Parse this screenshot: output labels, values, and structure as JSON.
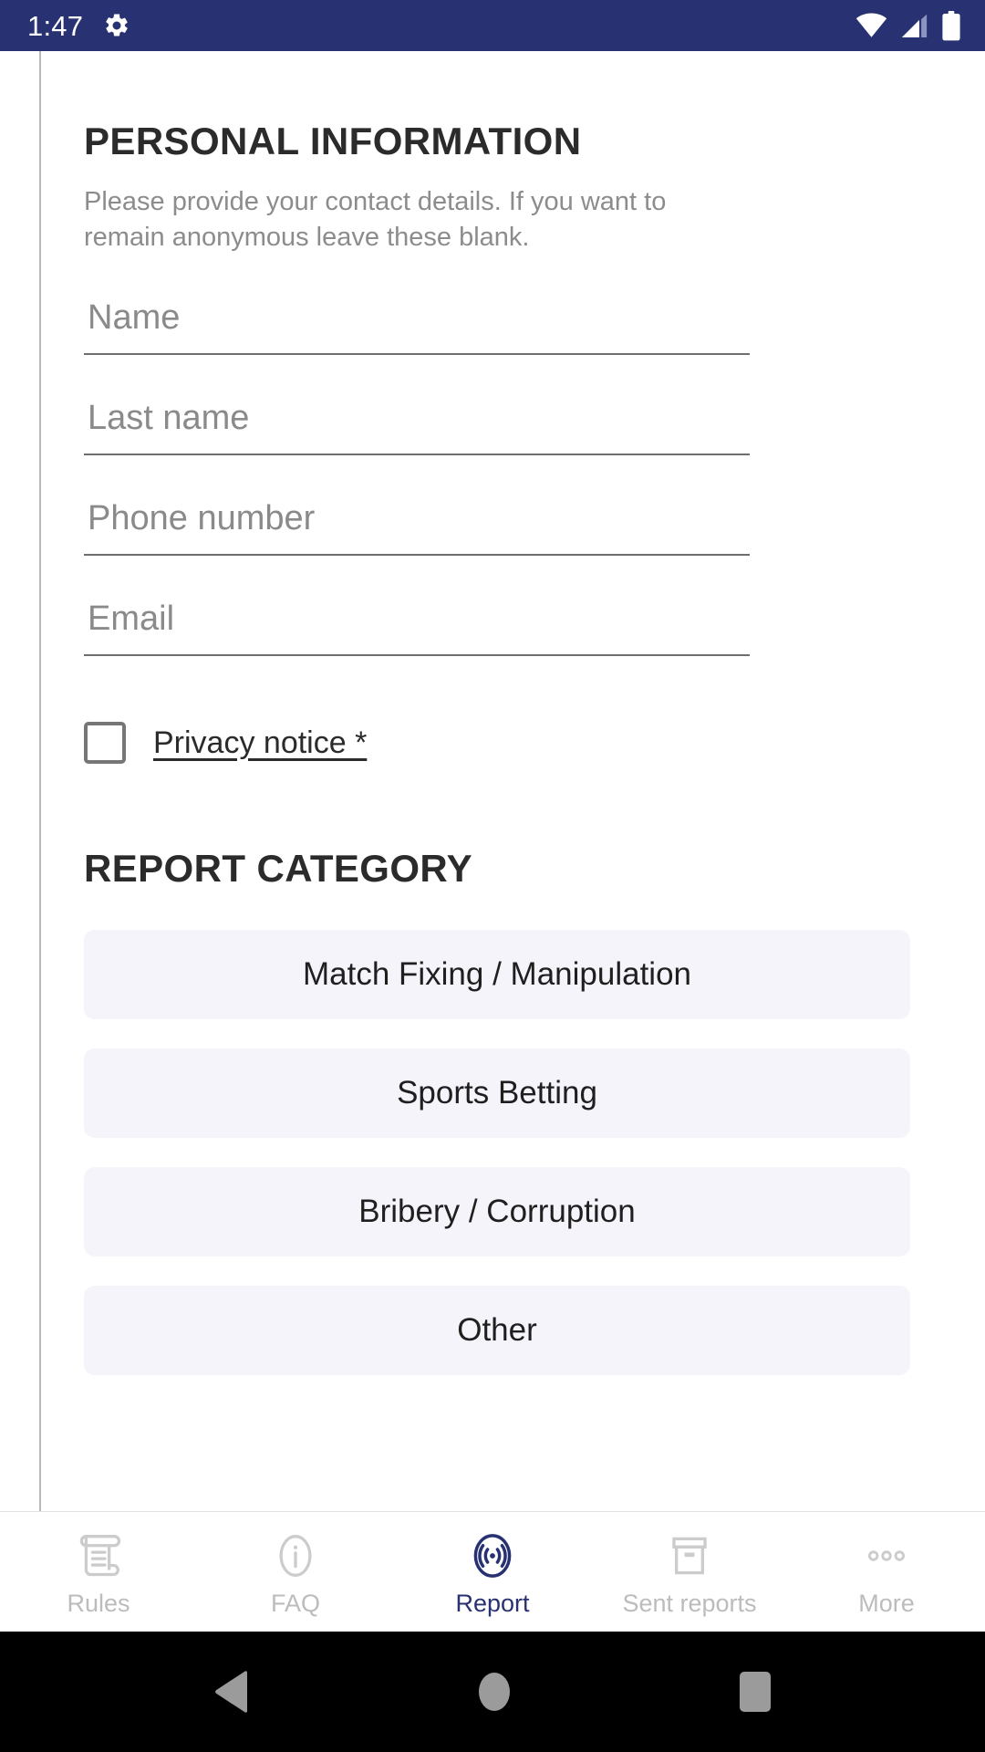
{
  "status_bar": {
    "time": "1:47",
    "gear_icon": "gear-icon",
    "wifi_icon": "wifi-icon",
    "signal_icon": "cell-signal-icon",
    "battery_icon": "battery-full-icon",
    "background_color": "#283272"
  },
  "sections": {
    "personal_information": {
      "title": "PERSONAL INFORMATION",
      "description": "Please provide your contact details. If you want to remain anonymous leave these blank.",
      "fields": [
        {
          "name": "name",
          "placeholder": "Name",
          "value": ""
        },
        {
          "name": "last_name",
          "placeholder": "Last name",
          "value": ""
        },
        {
          "name": "phone_number",
          "placeholder": "Phone number",
          "value": ""
        },
        {
          "name": "email",
          "placeholder": "Email",
          "value": ""
        }
      ],
      "privacy": {
        "label": "Privacy notice *",
        "checked": false
      }
    },
    "report_category": {
      "title": "REPORT CATEGORY",
      "options": [
        "Match Fixing / Manipulation",
        "Sports Betting",
        "Bribery / Corruption",
        "Other"
      ],
      "option_background": "#f5f4fa"
    }
  },
  "bottom_nav": {
    "active_color": "#283272",
    "inactive_color": "#bcbcbc",
    "items": [
      {
        "label": "Rules",
        "icon": "scroll-icon",
        "active": false
      },
      {
        "label": "FAQ",
        "icon": "info-circle-icon",
        "active": false
      },
      {
        "label": "Report",
        "icon": "broadcast-icon",
        "active": true
      },
      {
        "label": "Sent reports",
        "icon": "archive-box-icon",
        "active": false
      },
      {
        "label": "More",
        "icon": "three-dots-icon",
        "active": false
      }
    ]
  },
  "android_nav": {
    "back": "back-triangle-icon",
    "home": "home-circle-icon",
    "recents": "recents-square-icon"
  }
}
